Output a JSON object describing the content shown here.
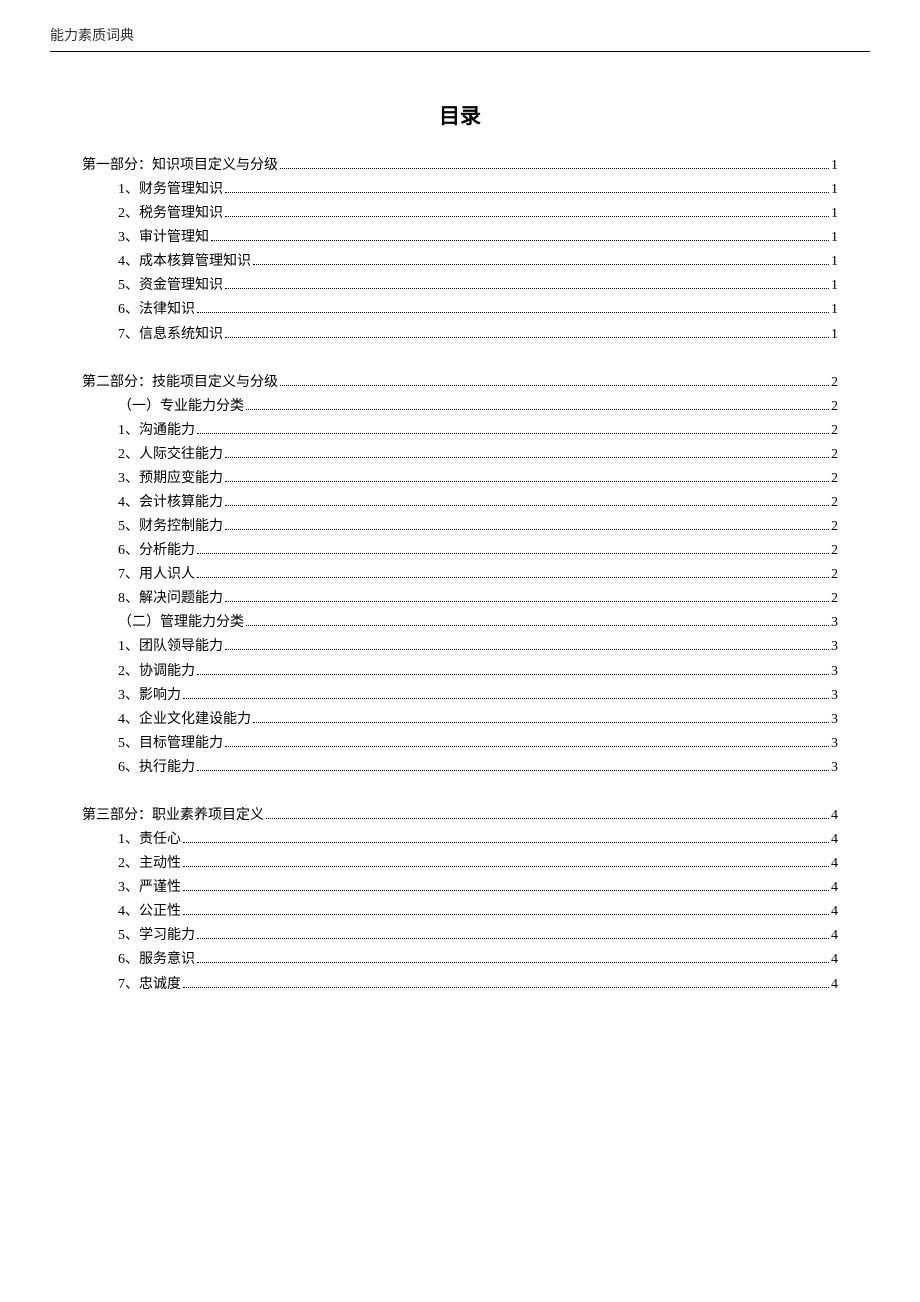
{
  "header": "能力素质词典",
  "title": "目录",
  "sections": [
    {
      "heading": {
        "label": "第一部分：知识项目定义与分级",
        "page": "1"
      },
      "items": [
        {
          "label": "1、财务管理知识",
          "page": "1"
        },
        {
          "label": "2、税务管理知识",
          "page": "1"
        },
        {
          "label": "3、审计管理知",
          "page": "1"
        },
        {
          "label": "4、成本核算管理知识",
          "page": "1"
        },
        {
          "label": "5、资金管理知识",
          "page": "1"
        },
        {
          "label": "6、法律知识",
          "page": "1"
        },
        {
          "label": "7、信息系统知识",
          "page": "1"
        }
      ]
    },
    {
      "heading": {
        "label": "第二部分：技能项目定义与分级",
        "page": "2"
      },
      "items": [
        {
          "label": "（一）专业能力分类",
          "page": "2"
        },
        {
          "label": "1、沟通能力",
          "page": "2"
        },
        {
          "label": "2、人际交往能力",
          "page": "2"
        },
        {
          "label": "3、预期应变能力",
          "page": "2"
        },
        {
          "label": "4、会计核算能力",
          "page": "2"
        },
        {
          "label": "5、财务控制能力",
          "page": "2"
        },
        {
          "label": "6、分析能力",
          "page": "2"
        },
        {
          "label": "7、用人识人",
          "page": "2"
        },
        {
          "label": "8、解决问题能力",
          "page": "2"
        },
        {
          "label": "（二）管理能力分类",
          "page": "3"
        },
        {
          "label": "1、团队领导能力",
          "page": "3"
        },
        {
          "label": "2、协调能力",
          "page": "3"
        },
        {
          "label": "3、影响力",
          "page": "3"
        },
        {
          "label": "4、企业文化建设能力",
          "page": "3"
        },
        {
          "label": "5、目标管理能力",
          "page": "3"
        },
        {
          "label": "6、执行能力",
          "page": "3"
        }
      ]
    },
    {
      "heading": {
        "label": "第三部分：职业素养项目定义",
        "page": "4"
      },
      "items": [
        {
          "label": "1、责任心",
          "page": "4"
        },
        {
          "label": "2、主动性",
          "page": "4"
        },
        {
          "label": "3、严谨性",
          "page": "4"
        },
        {
          "label": "4、公正性",
          "page": "4"
        },
        {
          "label": "5、学习能力",
          "page": "4"
        },
        {
          "label": "6、服务意识",
          "page": "4"
        },
        {
          "label": "7、忠诚度",
          "page": "4"
        }
      ]
    }
  ]
}
